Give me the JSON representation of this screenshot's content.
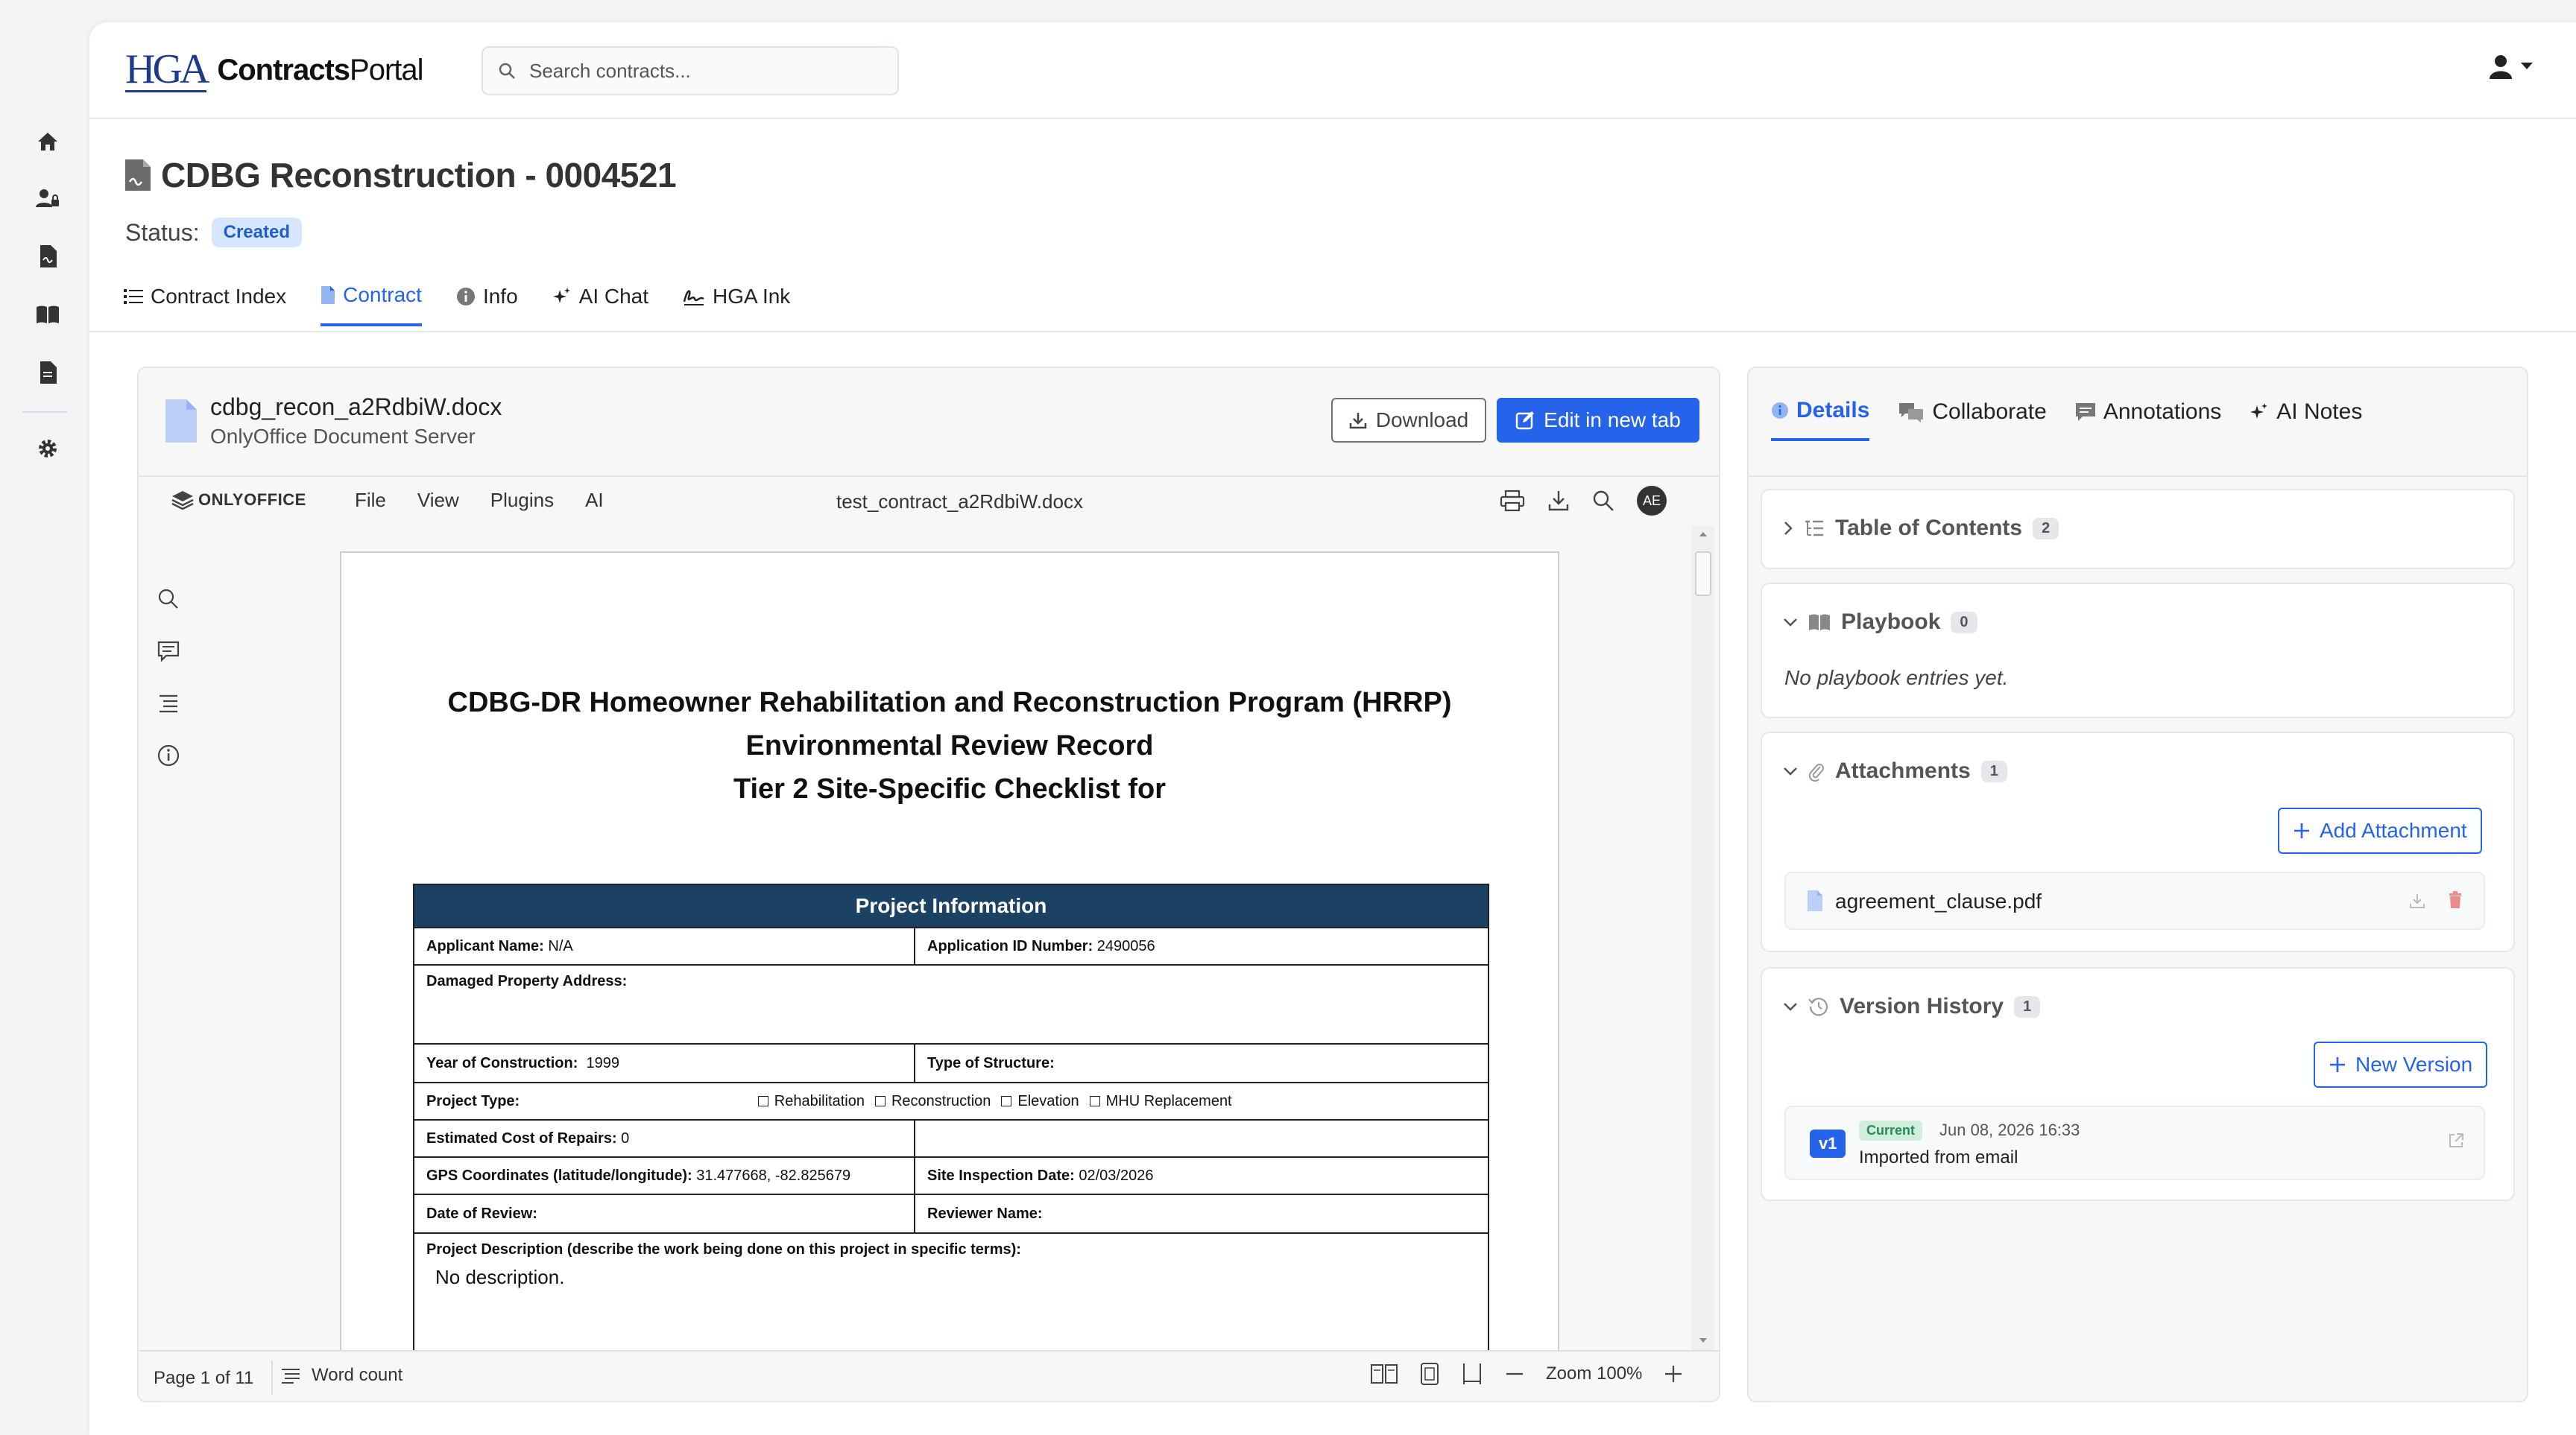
{
  "header": {
    "logo_mark": "HGA",
    "logo_bold": "Contracts",
    "logo_light": "Portal",
    "search_placeholder": "Search contracts..."
  },
  "page": {
    "title": "CDBG Reconstruction - 0004521",
    "status_label": "Status:",
    "status_value": "Created"
  },
  "tabs": [
    {
      "label": "Contract Index",
      "icon": "list-icon"
    },
    {
      "label": "Contract",
      "icon": "file-icon",
      "active": true
    },
    {
      "label": "Info",
      "icon": "info-icon"
    },
    {
      "label": "AI Chat",
      "icon": "sparkle-icon"
    },
    {
      "label": "HGA Ink",
      "icon": "signature-icon"
    }
  ],
  "document": {
    "file_name": "cdbg_recon_a2RdbiW.docx",
    "server": "OnlyOffice Document Server",
    "download_label": "Download",
    "edit_label": "Edit in new tab"
  },
  "onlyoffice": {
    "brand": "ONLYOFFICE",
    "menu": [
      "File",
      "View",
      "Plugins",
      "AI"
    ],
    "doc_name": "test_contract_a2RdbiW.docx",
    "avatar": "AE",
    "page_indicator": "Page 1 of 11",
    "word_count": "Word count",
    "zoom": "Zoom 100%"
  },
  "contract_doc": {
    "title_lines": [
      "CDBG-DR Homeowner Rehabilitation and Reconstruction Program (HRRP)",
      "Environmental Review Record",
      "Tier 2 Site-Specific Checklist for"
    ],
    "table_header": "Project Information",
    "applicant_name_label": "Applicant Name:",
    "applicant_name_value": "N/A",
    "application_id_label": "Application ID Number:",
    "application_id_value": "2490056",
    "address_label": "Damaged Property Address:",
    "year_label": "Year of Construction:",
    "year_value": "1999",
    "structure_label": "Type of Structure:",
    "project_type_label": "Project Type:",
    "project_types": [
      "Rehabilitation",
      "Reconstruction",
      "Elevation",
      "MHU Replacement"
    ],
    "cost_label": "Estimated Cost of Repairs:",
    "cost_value": "0",
    "gps_label": "GPS Coordinates (latitude/longitude):",
    "gps_value": "31.477668, -82.825679",
    "inspection_label": "Site Inspection Date:",
    "inspection_value": "02/03/2026",
    "review_date_label": "Date of Review:",
    "reviewer_label": "Reviewer Name:",
    "description_label": "Project Description (describe the work being done on this project in specific terms):",
    "description_value": "No description."
  },
  "right_panel": {
    "tabs": [
      {
        "label": "Details",
        "active": true
      },
      {
        "label": "Collaborate"
      },
      {
        "label": "Annotations"
      },
      {
        "label": "AI Notes"
      }
    ],
    "toc": {
      "title": "Table of Contents",
      "count": "2"
    },
    "playbook": {
      "title": "Playbook",
      "count": "0",
      "empty": "No playbook entries yet."
    },
    "attachments": {
      "title": "Attachments",
      "count": "1",
      "add_label": "Add Attachment",
      "files": [
        "agreement_clause.pdf"
      ]
    },
    "versions": {
      "title": "Version History",
      "count": "1",
      "new_label": "New Version",
      "items": [
        {
          "tag": "v1",
          "current": "Current",
          "date": "Jun 08, 2026 16:33",
          "note": "Imported from email"
        }
      ]
    }
  },
  "colors": {
    "accent": "#2563eb",
    "table_header": "#1b4262",
    "logo": "#1e3a8a"
  }
}
